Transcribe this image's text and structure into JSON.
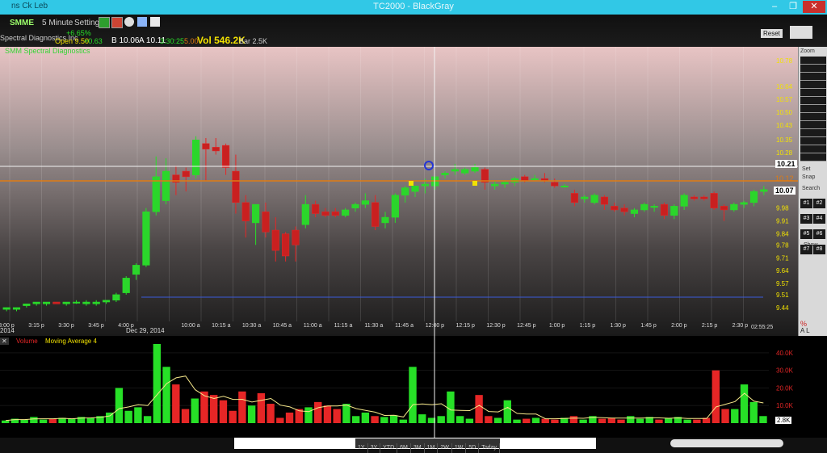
{
  "window": {
    "title": "TC2000 - BlackGray",
    "app_label": "ns Ck Leb",
    "controls": {
      "minimize": "–",
      "restore": "❐",
      "close": "✕"
    }
  },
  "toolbar": {
    "symbol": "SMME",
    "timeframe": "5 Minute",
    "settings": "Settings",
    "company": "Spectral Diagnostics Inc",
    "open_label": "Open 9.50",
    "change": "+0.63",
    "change_pct": "+6.65%",
    "bid": "B 10.06",
    "ask": "A 10.11",
    "time": "3:30:25",
    "avg": "5.00",
    "vol": "Vol 546.2K",
    "bar": "Bar 2.5K",
    "layout_btn": "Reset"
  },
  "chart": {
    "study_label": "SMM Spectral Diagnostics",
    "price_ticks": [
      "10.78",
      "10.64",
      "10.57",
      "10.50",
      "10.43",
      "10.35",
      "10.28",
      "10.21",
      "10.07",
      "9.98",
      "9.91",
      "9.84",
      "9.78",
      "9.71",
      "9.64",
      "9.57",
      "9.51",
      "9.44"
    ],
    "current_price": "10.07",
    "crosshair_price": "10.21",
    "orange_line_label": "10.12",
    "time_ticks": [
      "3:00 p",
      "3:15 p",
      "3:30 p",
      "3:45 p",
      "4:00 p",
      "10:00 a",
      "10:15 a",
      "10:30 a",
      "10:45 a",
      "11:00 a",
      "11:15 a",
      "11:30 a",
      "11:45 a",
      "12:00 p",
      "12:15 p",
      "12:30 p",
      "12:45 p",
      "1:00 p",
      "1:15 p",
      "1:30 p",
      "1:45 p",
      "2:00 p",
      "2:15 p",
      "2:30 p"
    ],
    "date_label_left": "2014",
    "date_label": "Dec 29, 2014",
    "clock": "02:55:25"
  },
  "chart_data": {
    "type": "candlestick",
    "title": "SMM Spectral Diagnostics",
    "xlabel": "",
    "ylabel": "",
    "ylim": [
      9.4,
      10.82
    ],
    "candles": [
      {
        "o": 9.43,
        "h": 9.44,
        "l": 9.42,
        "c": 9.44
      },
      {
        "o": 9.43,
        "h": 9.44,
        "l": 9.42,
        "c": 9.44
      },
      {
        "o": 9.45,
        "h": 9.46,
        "l": 9.44,
        "c": 9.46
      },
      {
        "o": 9.46,
        "h": 9.47,
        "l": 9.45,
        "c": 9.47
      },
      {
        "o": 9.46,
        "h": 9.47,
        "l": 9.45,
        "c": 9.47
      },
      {
        "o": 9.47,
        "h": 9.47,
        "l": 9.46,
        "c": 9.46
      },
      {
        "o": 9.46,
        "h": 9.47,
        "l": 9.45,
        "c": 9.47
      },
      {
        "o": 9.47,
        "h": 9.48,
        "l": 9.46,
        "c": 9.47
      },
      {
        "o": 9.46,
        "h": 9.48,
        "l": 9.45,
        "c": 9.47
      },
      {
        "o": 9.46,
        "h": 9.48,
        "l": 9.45,
        "c": 9.47
      },
      {
        "o": 9.47,
        "h": 9.48,
        "l": 9.46,
        "c": 9.48
      },
      {
        "o": 9.48,
        "h": 9.52,
        "l": 9.47,
        "c": 9.51
      },
      {
        "o": 9.52,
        "h": 9.61,
        "l": 9.51,
        "c": 9.6
      },
      {
        "o": 9.62,
        "h": 9.68,
        "l": 9.59,
        "c": 9.67
      },
      {
        "o": 9.67,
        "h": 9.98,
        "l": 9.66,
        "c": 9.96
      },
      {
        "o": 9.96,
        "h": 10.26,
        "l": 9.94,
        "c": 10.15
      },
      {
        "o": 10.02,
        "h": 10.25,
        "l": 10.0,
        "c": 10.18
      },
      {
        "o": 10.16,
        "h": 10.21,
        "l": 10.05,
        "c": 10.12
      },
      {
        "o": 10.18,
        "h": 10.2,
        "l": 10.07,
        "c": 10.15
      },
      {
        "o": 10.16,
        "h": 10.37,
        "l": 10.14,
        "c": 10.35
      },
      {
        "o": 10.33,
        "h": 10.36,
        "l": 10.13,
        "c": 10.3
      },
      {
        "o": 10.31,
        "h": 10.36,
        "l": 10.27,
        "c": 10.29
      },
      {
        "o": 10.32,
        "h": 10.33,
        "l": 10.16,
        "c": 10.2
      },
      {
        "o": 10.18,
        "h": 10.27,
        "l": 9.95,
        "c": 10.01
      },
      {
        "o": 10.01,
        "h": 10.05,
        "l": 9.82,
        "c": 9.91
      },
      {
        "o": 9.9,
        "h": 10.0,
        "l": 9.78,
        "c": 10.0
      },
      {
        "o": 9.96,
        "h": 10.01,
        "l": 9.82,
        "c": 9.85
      },
      {
        "o": 9.86,
        "h": 9.93,
        "l": 9.69,
        "c": 9.75
      },
      {
        "o": 9.84,
        "h": 9.85,
        "l": 9.69,
        "c": 9.72
      },
      {
        "o": 9.86,
        "h": 9.88,
        "l": 9.69,
        "c": 9.78
      },
      {
        "o": 9.89,
        "h": 10.05,
        "l": 9.87,
        "c": 10.0
      },
      {
        "o": 10.0,
        "h": 10.02,
        "l": 9.93,
        "c": 9.95
      },
      {
        "o": 9.96,
        "h": 9.98,
        "l": 9.93,
        "c": 9.94
      },
      {
        "o": 9.96,
        "h": 9.98,
        "l": 9.93,
        "c": 9.94
      },
      {
        "o": 9.94,
        "h": 9.98,
        "l": 9.93,
        "c": 9.97
      },
      {
        "o": 9.98,
        "h": 10.01,
        "l": 9.96,
        "c": 10.0
      },
      {
        "o": 10.0,
        "h": 10.06,
        "l": 9.98,
        "c": 10.02
      },
      {
        "o": 10.01,
        "h": 10.05,
        "l": 9.86,
        "c": 9.88
      },
      {
        "o": 9.9,
        "h": 9.96,
        "l": 9.87,
        "c": 9.93
      },
      {
        "o": 9.93,
        "h": 10.06,
        "l": 9.9,
        "c": 10.05
      },
      {
        "o": 10.05,
        "h": 10.1,
        "l": 10.01,
        "c": 10.09
      },
      {
        "o": 10.07,
        "h": 10.1,
        "l": 10.04,
        "c": 10.1
      },
      {
        "o": 10.1,
        "h": 10.14,
        "l": 10.06,
        "c": 10.11
      },
      {
        "o": 10.1,
        "h": 10.15,
        "l": 10.08,
        "c": 10.15
      },
      {
        "o": 10.16,
        "h": 10.18,
        "l": 10.14,
        "c": 10.17
      },
      {
        "o": 10.18,
        "h": 10.22,
        "l": 10.16,
        "c": 10.19
      },
      {
        "o": 10.17,
        "h": 10.2,
        "l": 10.16,
        "c": 10.19
      },
      {
        "o": 10.18,
        "h": 10.22,
        "l": 10.17,
        "c": 10.2
      },
      {
        "o": 10.19,
        "h": 10.2,
        "l": 10.08,
        "c": 10.12
      },
      {
        "o": 10.1,
        "h": 10.13,
        "l": 10.08,
        "c": 10.11
      },
      {
        "o": 10.11,
        "h": 10.13,
        "l": 10.09,
        "c": 10.12
      },
      {
        "o": 10.12,
        "h": 10.15,
        "l": 10.1,
        "c": 10.14
      },
      {
        "o": 10.15,
        "h": 10.16,
        "l": 10.12,
        "c": 10.13
      },
      {
        "o": 10.14,
        "h": 10.16,
        "l": 10.13,
        "c": 10.14
      },
      {
        "o": 10.14,
        "h": 10.17,
        "l": 10.12,
        "c": 10.13
      },
      {
        "o": 10.12,
        "h": 10.14,
        "l": 10.09,
        "c": 10.1
      },
      {
        "o": 10.1,
        "h": 10.11,
        "l": 10.09,
        "c": 10.1
      },
      {
        "o": 10.06,
        "h": 10.08,
        "l": 9.99,
        "c": 10.01
      },
      {
        "o": 10.03,
        "h": 10.05,
        "l": 10.01,
        "c": 10.04
      },
      {
        "o": 10.01,
        "h": 10.06,
        "l": 10.0,
        "c": 10.05
      },
      {
        "o": 10.04,
        "h": 10.05,
        "l": 9.97,
        "c": 10.0
      },
      {
        "o": 9.99,
        "h": 10.01,
        "l": 9.96,
        "c": 9.97
      },
      {
        "o": 9.98,
        "h": 10.0,
        "l": 9.94,
        "c": 9.96
      },
      {
        "o": 9.95,
        "h": 9.98,
        "l": 9.93,
        "c": 9.97
      },
      {
        "o": 9.97,
        "h": 10.01,
        "l": 9.96,
        "c": 10.0
      },
      {
        "o": 9.99,
        "h": 10.0,
        "l": 9.96,
        "c": 9.99
      },
      {
        "o": 10.0,
        "h": 10.01,
        "l": 9.92,
        "c": 9.94
      },
      {
        "o": 9.94,
        "h": 10.0,
        "l": 9.92,
        "c": 9.99
      },
      {
        "o": 9.99,
        "h": 10.06,
        "l": 9.97,
        "c": 10.05
      },
      {
        "o": 10.04,
        "h": 10.05,
        "l": 10.02,
        "c": 10.03
      },
      {
        "o": 10.04,
        "h": 10.05,
        "l": 10.02,
        "c": 10.03
      },
      {
        "o": 10.06,
        "h": 10.07,
        "l": 9.97,
        "c": 9.98
      },
      {
        "o": 9.99,
        "h": 10.0,
        "l": 9.91,
        "c": 9.97
      },
      {
        "o": 9.97,
        "h": 10.01,
        "l": 9.96,
        "c": 10.0
      },
      {
        "o": 10.0,
        "h": 10.02,
        "l": 9.98,
        "c": 10.01
      },
      {
        "o": 10.01,
        "h": 10.08,
        "l": 9.99,
        "c": 10.07
      },
      {
        "o": 10.07,
        "h": 10.1,
        "l": 10.05,
        "c": 10.08
      }
    ],
    "volume_axis": [
      "40.0K",
      "30.0K",
      "20.0K",
      "10.0K"
    ],
    "volume_current": "2.8K",
    "volume_ylim": [
      0,
      45000
    ],
    "volume": [
      1500,
      2500,
      2000,
      3500,
      2000,
      2500,
      3000,
      2500,
      3500,
      3000,
      4000,
      6000,
      20000,
      7000,
      9000,
      4000,
      45000,
      32000,
      22000,
      8000,
      14000,
      18000,
      16000,
      13000,
      7000,
      18000,
      10000,
      17000,
      11000,
      3000,
      6000,
      8000,
      9000,
      12000,
      10000,
      8000,
      11000,
      4000,
      6000,
      4000,
      3500,
      4500,
      2000,
      32000,
      5000,
      3000,
      4000,
      18000,
      4000,
      2500,
      16000,
      4000,
      3000,
      13000,
      2000,
      2500,
      3000,
      2500,
      2000,
      3000,
      4000,
      2000,
      4000,
      2500,
      3000,
      2000,
      4000,
      2500,
      3500,
      2000,
      3000,
      3500,
      2000,
      2000,
      3000,
      30000,
      8000,
      8000,
      22000,
      12000,
      4000
    ]
  },
  "volume_panel": {
    "label": "Volume",
    "ma_label": "Moving Average 4"
  },
  "right_panel": {
    "header": "Zoom",
    "set_label": "Set",
    "snap_label": "Snap",
    "search_label": "Search",
    "slots": [
      "#1",
      "#2",
      "#3",
      "#4",
      "#5",
      "#6",
      "#7",
      "#8"
    ],
    "show_label": "Show",
    "al_label": "A L",
    "pct_label": "%"
  },
  "bottom": {
    "tabs": [
      "1Y",
      "3Y",
      "YTD",
      "6M",
      "3M",
      "1M",
      "2W",
      "1W",
      "5D",
      "Today"
    ]
  },
  "colors": {
    "up": "#27e027",
    "down": "#e62626",
    "title_bar": "#31c8e6",
    "ma": "#f6e88a",
    "hline_blue": "#3b5bdb",
    "hline_orange": "#e07b12"
  }
}
